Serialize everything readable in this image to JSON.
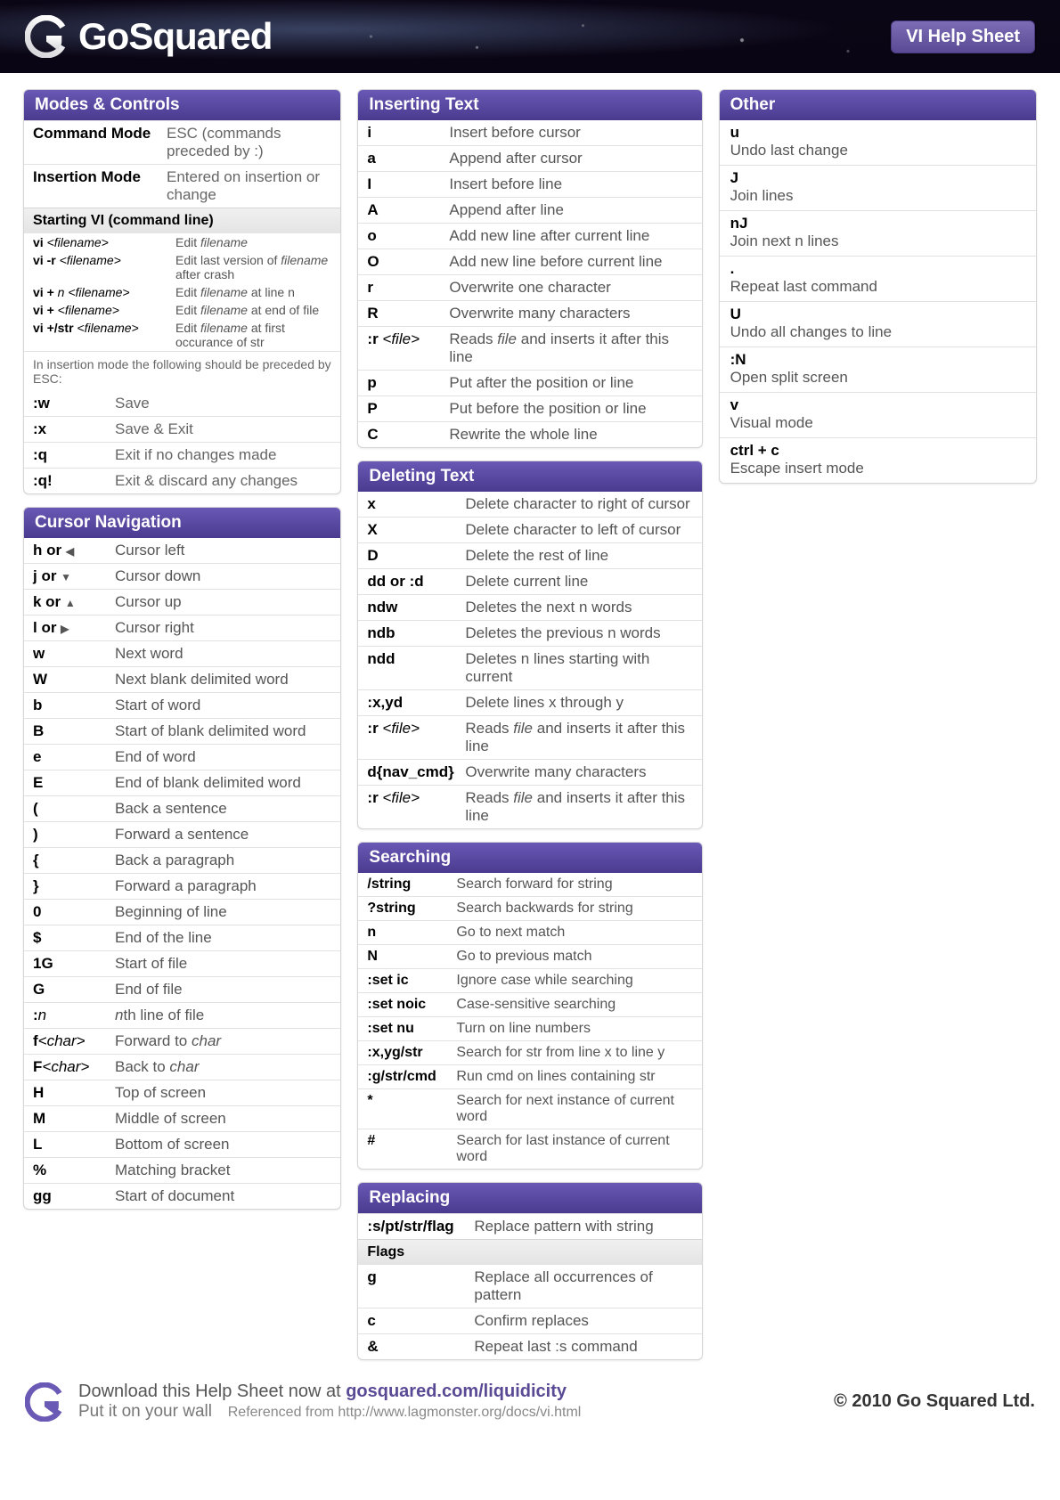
{
  "brand": "GoSquared",
  "badge": "VI Help Sheet",
  "sections": {
    "modes": {
      "title": "Modes & Controls",
      "top": [
        {
          "cmd": "Command Mode",
          "desc": "ESC (commands preceded by :)"
        },
        {
          "cmd": "Insertion Mode",
          "desc": "Entered on insertion or change"
        }
      ],
      "sub_title": "Starting VI (command line)",
      "starting": [
        {
          "cmd_p": "vi ",
          "cmd_i": "<filename>",
          "d_p": "Edit ",
          "d_i": "filename",
          "d_s": ""
        },
        {
          "cmd_p": "vi -r ",
          "cmd_i": "<filename>",
          "d_p": "Edit last version of ",
          "d_i": "filename",
          "d_s": " after crash"
        },
        {
          "cmd_p": "vi + ",
          "cmd_i": "n <filename>",
          "d_p": "Edit ",
          "d_i": "filename",
          "d_s": " at line n"
        },
        {
          "cmd_p": "vi + ",
          "cmd_i": "<filename>",
          "d_p": "Edit ",
          "d_i": "filename",
          "d_s": " at end of file"
        },
        {
          "cmd_p": "vi +/str ",
          "cmd_i": "<filename>",
          "d_p": "Edit ",
          "d_i": "filename",
          "d_s": " at first occurance of str"
        }
      ],
      "note": "In insertion mode the following should be preceded by ESC:",
      "save": [
        {
          "cmd": ":w",
          "desc": "Save"
        },
        {
          "cmd": ":x",
          "desc": "Save & Exit"
        },
        {
          "cmd": ":q",
          "desc": "Exit if no changes made"
        },
        {
          "cmd": ":q!",
          "desc": "Exit & discard any changes"
        }
      ]
    },
    "nav": {
      "title": "Cursor Navigation",
      "rows": [
        {
          "cmd": "h or ",
          "arrow": "l",
          "desc": "Cursor left"
        },
        {
          "cmd": "j or ",
          "arrow": "d",
          "desc": "Cursor down"
        },
        {
          "cmd": "k or ",
          "arrow": "u",
          "desc": "Cursor up"
        },
        {
          "cmd": "l or  ",
          "arrow": "r",
          "desc": "Cursor right"
        },
        {
          "cmd": "w",
          "desc": "Next word"
        },
        {
          "cmd": "W",
          "desc": "Next blank delimited word"
        },
        {
          "cmd": "b",
          "desc": "Start of word"
        },
        {
          "cmd": "B",
          "desc": "Start of blank delimited word"
        },
        {
          "cmd": "e",
          "desc": "End of word"
        },
        {
          "cmd": "E",
          "desc": "End of blank delimited word"
        },
        {
          "cmd": "(",
          "desc": "Back a sentence"
        },
        {
          "cmd": ")",
          "desc": "Forward a sentence"
        },
        {
          "cmd": "{",
          "desc": "Back a paragraph"
        },
        {
          "cmd": "}",
          "desc": "Forward a paragraph"
        },
        {
          "cmd": "0",
          "desc": "Beginning of line"
        },
        {
          "cmd": "$",
          "desc": "End of the line"
        },
        {
          "cmd": "1G",
          "desc": "Start of file"
        },
        {
          "cmd": "G",
          "desc": "End of file"
        },
        {
          "cmd": ":",
          "cmd_i": "n",
          "desc_i": "n",
          "desc": "th line of file"
        },
        {
          "cmd": "f",
          "cmd_i": "<char>",
          "desc": "Forward to ",
          "desc_i2": "char"
        },
        {
          "cmd": "F",
          "cmd_i": "<char>",
          "desc": "Back to ",
          "desc_i2": "char"
        },
        {
          "cmd": "H",
          "desc": "Top of screen"
        },
        {
          "cmd": "M",
          "desc": "Middle of screen"
        },
        {
          "cmd": "L",
          "desc": "Bottom of screen"
        },
        {
          "cmd": "%",
          "desc": "Matching bracket"
        },
        {
          "cmd": "gg",
          "desc": "Start of document"
        }
      ]
    },
    "ins": {
      "title": "Inserting Text",
      "rows": [
        {
          "cmd": "i",
          "desc": "Insert before cursor"
        },
        {
          "cmd": "a",
          "desc": "Append after cursor"
        },
        {
          "cmd": "I",
          "desc": "Insert before line"
        },
        {
          "cmd": "A",
          "desc": "Append after line"
        },
        {
          "cmd": "o",
          "desc": "Add new line after current line"
        },
        {
          "cmd": "O",
          "desc": "Add new line before current line"
        },
        {
          "cmd": "r",
          "desc": "Overwrite one character"
        },
        {
          "cmd": "R",
          "desc": "Overwrite many characters"
        },
        {
          "cmd": ":r ",
          "cmd_i": "<file>",
          "desc": "Reads ",
          "desc_i": "file",
          "desc_s": " and inserts it after this line"
        },
        {
          "cmd": "p",
          "desc": "Put after the position or line"
        },
        {
          "cmd": "P",
          "desc": "Put before the position or line"
        },
        {
          "cmd": "C",
          "desc": "Rewrite the whole line"
        }
      ]
    },
    "del": {
      "title": "Deleting Text",
      "rows": [
        {
          "cmd": "x",
          "desc": "Delete character to right of cursor"
        },
        {
          "cmd": "X",
          "desc": "Delete character to left of cursor"
        },
        {
          "cmd": "D",
          "desc": "Delete the rest of line"
        },
        {
          "cmd": "dd or :d",
          "desc": "Delete current line"
        },
        {
          "cmd": "ndw",
          "desc": "Deletes the next n words"
        },
        {
          "cmd": "ndb",
          "desc": "Deletes the previous n words"
        },
        {
          "cmd": "ndd",
          "desc": "Deletes n lines starting with current"
        },
        {
          "cmd": ":x,yd",
          "desc": "Delete lines x through y"
        },
        {
          "cmd": ":r ",
          "cmd_i": "<file>",
          "desc": "Reads ",
          "desc_i": "file",
          "desc_s": " and inserts it after this line"
        },
        {
          "cmd": "d{nav_cmd}",
          "desc": "Overwrite many characters"
        },
        {
          "cmd": ":r ",
          "cmd_i": "<file>",
          "desc": "Reads ",
          "desc_i": "file",
          "desc_s": " and inserts it after this line"
        }
      ]
    },
    "sch": {
      "title": "Searching",
      "rows": [
        {
          "cmd": "/string",
          "desc": "Search forward for string"
        },
        {
          "cmd": "?string",
          "desc": "Search backwards for string"
        },
        {
          "cmd": "n",
          "desc": "Go to next match"
        },
        {
          "cmd": "N",
          "desc": "Go to previous match"
        },
        {
          "cmd": ":set ic",
          "desc": "Ignore case while searching"
        },
        {
          "cmd": ":set noic",
          "desc": "Case-sensitive searching"
        },
        {
          "cmd": ":set nu",
          "desc": "Turn on line numbers"
        },
        {
          "cmd": ":x,yg/str",
          "desc": "Search for str from line x to line y"
        },
        {
          "cmd": ":g/str/cmd",
          "desc": "Run cmd on lines containing str"
        },
        {
          "cmd": "*",
          "desc": "Search for next instance of current word"
        },
        {
          "cmd": "#",
          "desc": "Search for last instance of current word"
        }
      ]
    },
    "rep": {
      "title": "Replacing",
      "rows": [
        {
          "cmd": ":s/pt/str/flag",
          "desc": "Replace pattern with string"
        }
      ],
      "sub_title": "Flags",
      "flags": [
        {
          "cmd": "g",
          "desc": "Replace all occurrences of pattern"
        },
        {
          "cmd": "c",
          "desc": "Confirm replaces"
        },
        {
          "cmd": "&",
          "desc": "Repeat last :s command"
        }
      ]
    },
    "oth": {
      "title": "Other",
      "rows": [
        {
          "cmd": "u",
          "desc": "Undo last change"
        },
        {
          "cmd": "J",
          "desc": "Join lines"
        },
        {
          "cmd": "nJ",
          "desc": "Join next n lines"
        },
        {
          "cmd": ".",
          "desc": "Repeat last command"
        },
        {
          "cmd": "U",
          "desc": "Undo all changes to line"
        },
        {
          "cmd": ":N",
          "desc": "Open split screen"
        },
        {
          "cmd": "v",
          "desc": "Visual mode"
        },
        {
          "cmd": "ctrl + c",
          "desc": "Escape insert mode"
        }
      ]
    }
  },
  "footer": {
    "line1_a": "Download this Help Sheet now at ",
    "line1_b": "gosquared.com/liquidicity",
    "line2_a": "Put it on your wall",
    "line2_b": "Referenced from http://www.lagmonster.org/docs/vi.html",
    "copyright": "© 2010 Go Squared Ltd."
  }
}
